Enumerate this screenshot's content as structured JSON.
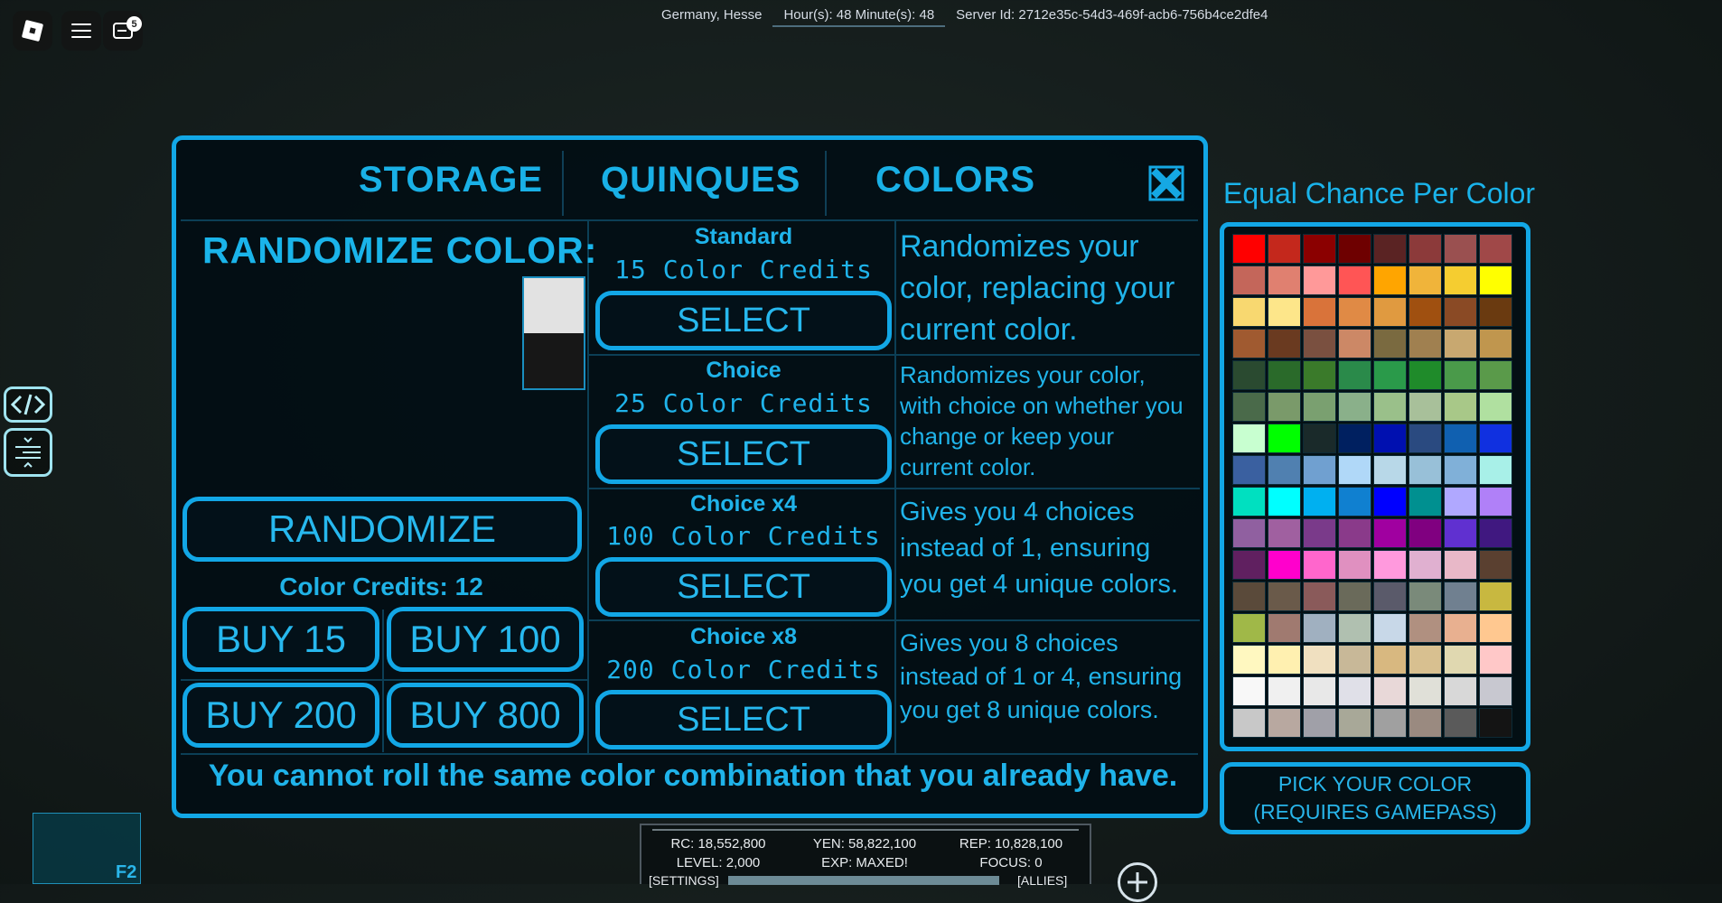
{
  "topbar": {
    "notification_count": "5",
    "location": "Germany, Hesse",
    "time": "Hour(s): 48 Minute(s): 48",
    "server_id": "Server Id: 2712e35c-54d3-469f-acb6-756b4ce2dfe4"
  },
  "tabs": [
    {
      "label": "STORAGE"
    },
    {
      "label": "QUINQUES"
    },
    {
      "label": "COLORS"
    }
  ],
  "randomize": {
    "title": "RANDOMIZE COLOR:",
    "button": "RANDOMIZE",
    "credits": "Color Credits: 12",
    "buy": [
      "BUY 15",
      "BUY 100",
      "BUY 200",
      "BUY 800"
    ]
  },
  "options": [
    {
      "name": "Standard",
      "cost": "15 Color Credits",
      "select": "SELECT",
      "desc": [
        "Randomizes your",
        "color, replacing your",
        "current color."
      ]
    },
    {
      "name": "Choice",
      "cost": "25 Color Credits",
      "select": "SELECT",
      "desc": [
        "Randomizes your color,",
        "with choice on whether you",
        "change or keep your",
        "current color."
      ]
    },
    {
      "name": "Choice x4",
      "cost": "100 Color Credits",
      "select": "SELECT",
      "desc": [
        "Gives you 4 choices",
        "instead of 1, ensuring",
        "you get 4 unique colors."
      ]
    },
    {
      "name": "Choice x8",
      "cost": "200 Color Credits",
      "select": "SELECT",
      "desc": [
        "Gives you 8 choices",
        "instead of 1 or 4, ensuring",
        "you get 8 unique colors."
      ]
    }
  ],
  "footer": "You cannot roll the same color combination that you already have.",
  "colorgrid": {
    "title": "Equal Chance Per Color",
    "pick_line1": "PICK YOUR COLOR",
    "pick_line2": "(REQUIRES GAMEPASS)",
    "colors": [
      "#ff0000",
      "#c4281c",
      "#8b0000",
      "#6e0000",
      "#5a2323",
      "#8c3a3a",
      "#9a5050",
      "#a04848",
      "#c4665a",
      "#e08070",
      "#ff9999",
      "#ff5555",
      "#ffa500",
      "#f0b43a",
      "#f5cd30",
      "#ffff00",
      "#f8d870",
      "#fde68a",
      "#d9733a",
      "#e08a45",
      "#e09a40",
      "#a05010",
      "#8a4a25",
      "#6a3a10",
      "#a05a30",
      "#6a3a20",
      "#7a5040",
      "#cc8866",
      "#7a6a40",
      "#a08050",
      "#c8a870",
      "#c0964e",
      "#2a4a30",
      "#2a6a2a",
      "#3a7a2a",
      "#2a8a4a",
      "#2a9a4a",
      "#1f8b2a",
      "#4a9a4a",
      "#5a9a4a",
      "#4a6a4a",
      "#7a9a6a",
      "#7aa070",
      "#8ab08a",
      "#9ac08a",
      "#a8c09a",
      "#a8c888",
      "#b0e0a0",
      "#c8ffd0",
      "#00ff00",
      "#1a2a2a",
      "#002060",
      "#0010b0",
      "#2a4a80",
      "#1060b0",
      "#1030e0",
      "#3a60a0",
      "#5080b0",
      "#70a0d0",
      "#b0d8f8",
      "#b8d8e8",
      "#98c0d8",
      "#80b0d8",
      "#a8f0e8",
      "#00e0c0",
      "#00ffff",
      "#00b0f0",
      "#1080d0",
      "#0000ff",
      "#009090",
      "#b0a8ff",
      "#b080f8",
      "#9060a0",
      "#a060a0",
      "#7a3a8a",
      "#8a3a8a",
      "#a000a0",
      "#800080",
      "#6030d0",
      "#401880",
      "#602060",
      "#ff00cc",
      "#ff66cc",
      "#e090c0",
      "#ff99dd",
      "#e0b0d0",
      "#e8b8c8",
      "#5a4030",
      "#5a4a3a",
      "#6a5a4a",
      "#8a5a5a",
      "#6a6a5a",
      "#5a5a6a",
      "#7a8a7a",
      "#708090",
      "#c8b840",
      "#a0b848",
      "#a07a70",
      "#a0b0c0",
      "#b0c0b0",
      "#c8d8e8",
      "#b09080",
      "#e8b090",
      "#ffc890",
      "#fff8c0",
      "#fff0b0",
      "#f0e0c0",
      "#c8b898",
      "#d8b880",
      "#d8c090",
      "#e0d8b0",
      "#ffc8c8",
      "#f8f8f8",
      "#f0f0f0",
      "#e8e8e8",
      "#e0e0e8",
      "#e8d8d8",
      "#e0e0d8",
      "#d8d8d8",
      "#c8c8d0",
      "#c8c8c8",
      "#b8a8a0",
      "#a0a0a8",
      "#a8a898",
      "#a0a0a0",
      "#9a8a80",
      "#5a5a5a",
      "#141414"
    ]
  },
  "stats": {
    "rc": "RC: 18,552,800",
    "yen": "YEN: 58,822,100",
    "rep": "REP: 10,828,100",
    "level": "LEVEL: 2,000",
    "exp": "EXP: MAXED!",
    "focus": "FOCUS: 0",
    "settings": "[SETTINGS]",
    "allies": "[ALLIES]"
  },
  "hotkey": "F2"
}
